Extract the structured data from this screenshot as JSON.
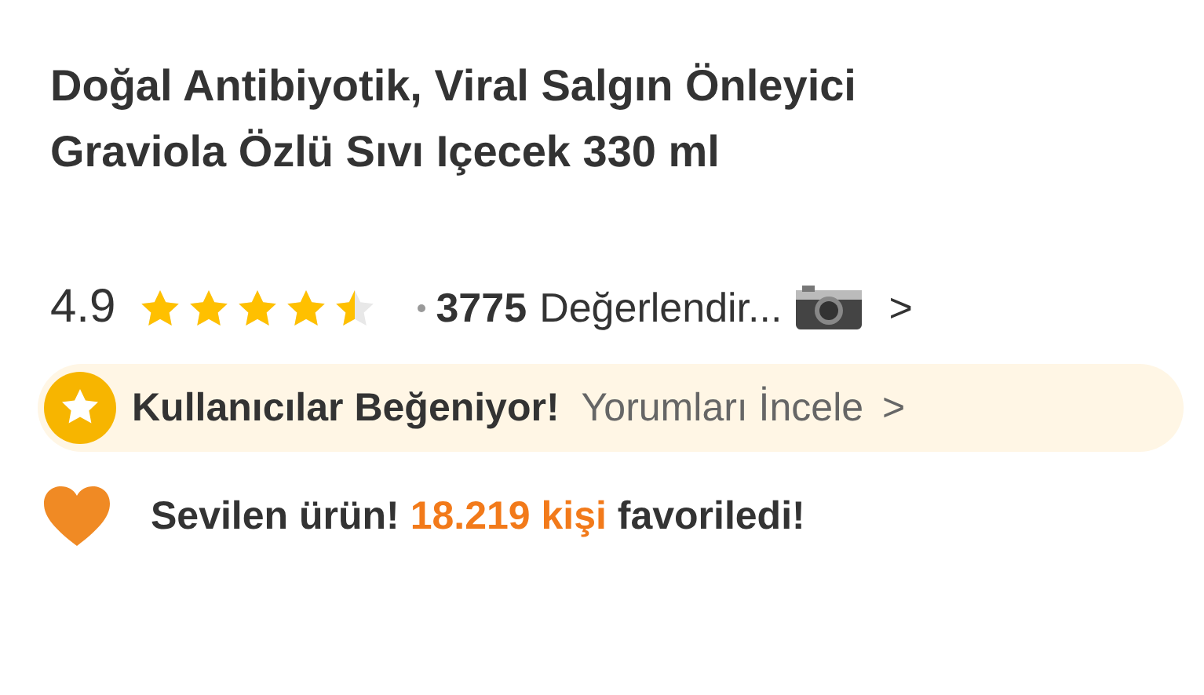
{
  "title": [
    "Doğal Antibiyotik, Viral Salgın Önleyici",
    "Graviola Özlü Sıvı Içecek 330 ml"
  ],
  "rating": {
    "score": "4.9",
    "stars": 4.5,
    "count": "3775",
    "label": "Değerlendir...",
    "chevron": ">"
  },
  "banner": {
    "title": "Kullanıcılar Beğeniyor!",
    "link": "Yorumları İncele",
    "chevron": ">"
  },
  "favorites": {
    "prefix": "Sevilen ürün! ",
    "highlight": "18.219 kişi",
    "suffix": " favoriledi!"
  }
}
